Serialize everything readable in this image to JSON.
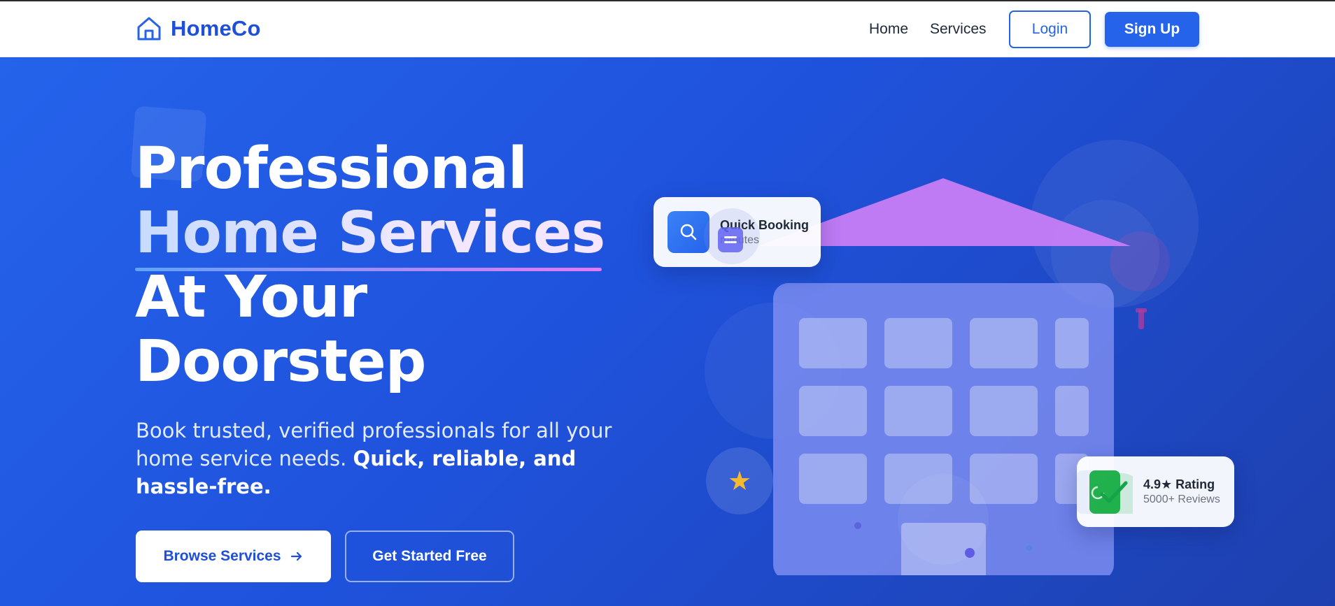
{
  "brand": {
    "name": "HomeCo",
    "icon": "home-outline-icon"
  },
  "nav": {
    "links": [
      "Home",
      "Services"
    ],
    "login_label": "Login",
    "signup_label": "Sign Up"
  },
  "hero": {
    "headline_line1": "Professional",
    "headline_line2": "Home Services",
    "headline_line3": "At Your",
    "headline_line4": "Doorstep",
    "subtext_plain": "Book trusted, verified professionals for all your home service needs.",
    "subtext_bold": "Quick, reliable, and hassle-free.",
    "browse_label": "Browse Services",
    "browse_icon": "arrow-right-icon",
    "getstarted_label": "Get Started Free"
  },
  "cards": {
    "quick_booking": {
      "title": "Quick Booking",
      "subtitle": "minutes",
      "icon": "search-icon"
    },
    "rating": {
      "title": "4.9★ Rating",
      "subtitle": "5000+ Reviews",
      "icon": "shield-check-icon"
    }
  },
  "colors": {
    "primary": "#2563eb",
    "hero_bg": "#2156e0",
    "roof": "#c084fc",
    "star": "#f5b82e",
    "rating_green": "#16a34a"
  }
}
